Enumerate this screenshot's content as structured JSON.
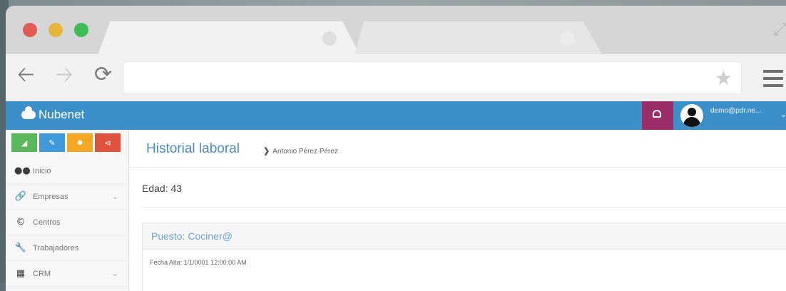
{
  "browser": {
    "window_controls": [
      "close",
      "minimize",
      "zoom"
    ],
    "address_value": "",
    "icons": {
      "back": "arrow-left-icon",
      "forward": "arrow-right-icon",
      "reload": "reload-icon",
      "bookmark": "star-icon",
      "menu": "hamburger-icon",
      "expand": "expand-icon"
    }
  },
  "app": {
    "brand": "Nubenet",
    "user_email": "demo@pdr.ne...",
    "colors": {
      "topbar": "#3d8fca",
      "notification": "#9b2d6b",
      "title": "#4a8cc2"
    }
  },
  "sidebar": {
    "quick_buttons": [
      {
        "icon": "chart-icon",
        "color": "#5bb75b"
      },
      {
        "icon": "pencil-icon",
        "color": "#3f99d8"
      },
      {
        "icon": "users-icon",
        "color": "#f5a623"
      },
      {
        "icon": "share-icon",
        "color": "#e0533e"
      }
    ],
    "items": [
      {
        "label": "Inicio",
        "icon": "binoculars-icon"
      },
      {
        "label": "Empresas",
        "icon": "link-icon",
        "has_submenu": true
      },
      {
        "label": "Centros",
        "icon": "circle-c-icon"
      },
      {
        "label": "Trabajadores",
        "icon": "wrench-icon"
      },
      {
        "label": "CRM",
        "icon": "calendar-icon",
        "has_submenu": true
      }
    ]
  },
  "main": {
    "title": "Historial laboral",
    "breadcrumb": "Antonio Pérez Pérez",
    "edad": "Edad: 43",
    "panel": {
      "title": "Puesto: Cociner@",
      "fecha_alta": "Fecha Alta: 1/1/0001 12:00:00 AM"
    }
  }
}
